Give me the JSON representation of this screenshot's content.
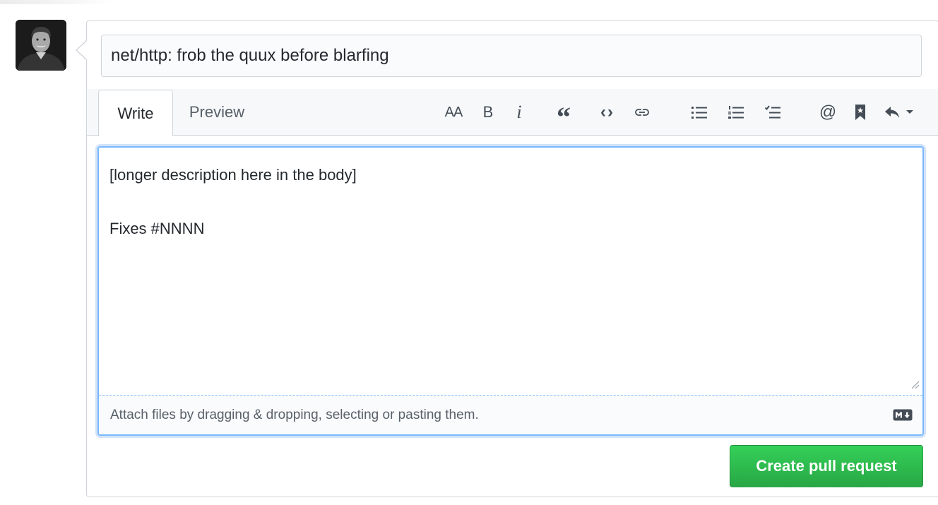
{
  "pull_request": {
    "title_value": "net/http: frob the quux before blarfing",
    "tabs": {
      "write_label": "Write",
      "preview_label": "Preview"
    },
    "body_text": "[longer description here in the body]\n\nFixes #NNNN",
    "attach_hint": "Attach files by dragging & dropping, selecting or pasting them.",
    "submit_label": "Create pull request"
  },
  "toolbar": {
    "heading_glyph": "AA",
    "bold_glyph": "B",
    "italic_glyph": "i",
    "quote_glyph": "“",
    "code_glyph": "‹›",
    "mention_glyph": "@",
    "icons": [
      "text-size-icon",
      "bold-icon",
      "italic-icon",
      "quote-icon",
      "code-icon",
      "link-icon",
      "bullet-list-icon",
      "numbered-list-icon",
      "task-list-icon",
      "mention-icon",
      "bookmark-icon",
      "reply-icon"
    ]
  },
  "colors": {
    "accent_blue": "#79b8ff",
    "button_green": "#2ea44f",
    "border": "#d1d5da"
  }
}
